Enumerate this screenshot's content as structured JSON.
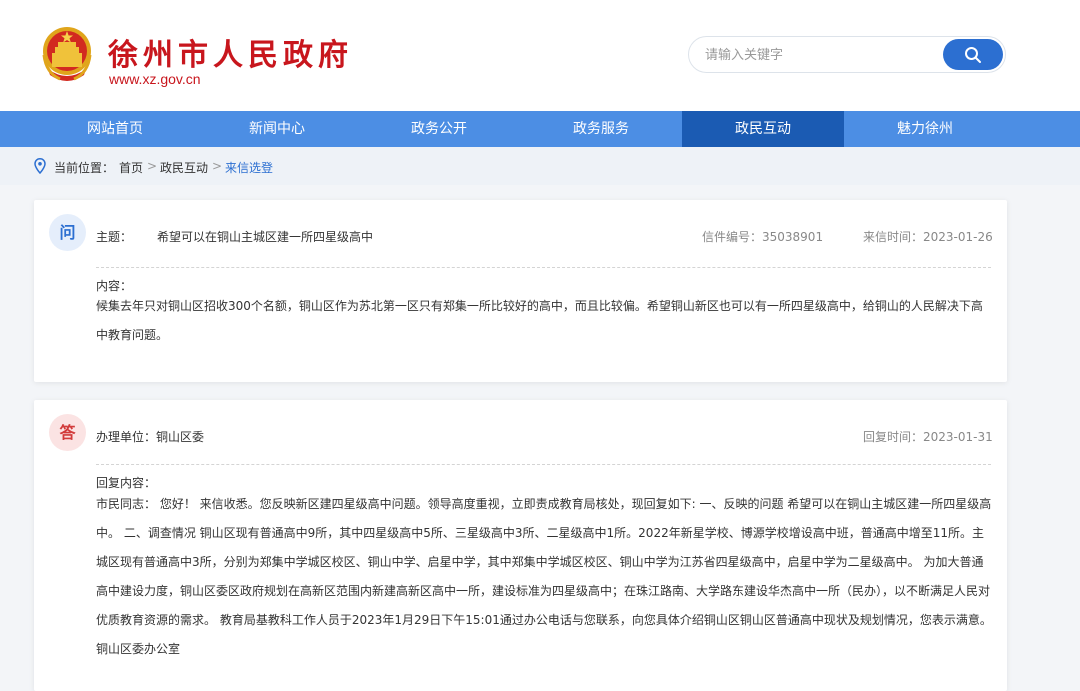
{
  "header": {
    "site_name": "徐州市人民政府",
    "site_url": "www.xz.gov.cn",
    "search_placeholder": "请输入关键字",
    "search_icon": "magnifier-icon",
    "emblem": "national-emblem-icon"
  },
  "nav": {
    "items": [
      {
        "label": "网站首页"
      },
      {
        "label": "新闻中心"
      },
      {
        "label": "政务公开"
      },
      {
        "label": "政务服务"
      },
      {
        "label": "政民互动",
        "active": true
      },
      {
        "label": "魅力徐州"
      }
    ]
  },
  "breadcrumb": {
    "prefix": "当前位置：",
    "home": "首页",
    "section": "政民互动",
    "current": "来信选登",
    "sep": ">"
  },
  "letter": {
    "badge": "问",
    "subject_label": "主题：",
    "subject": "希望可以在铜山主城区建一所四星级高中",
    "number_text": "信件编号：35038901",
    "date_text": "来信时间：2023-01-26",
    "content_label": "内容：",
    "content": "候集去年只对铜山区招收300个名额，铜山区作为苏北第一区只有郑集一所比较好的高中，而且比较偏。希望铜山新区也可以有一所四星级高中，给铜山的人民解决下高中教育问题。"
  },
  "reply": {
    "badge": "答",
    "unit_text": "办理单位：铜山区委",
    "date_text": "回复时间：2023-01-31",
    "content_label": "回复内容：",
    "content": "市民同志： 您好！ 来信收悉。您反映新区建四星级高中问题。领导高度重视，立即责成教育局核处，现回复如下: 一、反映的问题 希望可以在铜山主城区建一所四星级高中。 二、调查情况 铜山区现有普通高中9所，其中四星级高中5所、三星级高中3所、二星级高中1所。2022年新星学校、博源学校增设高中班，普通高中增至11所。主城区现有普通高中3所，分别为郑集中学城区校区、铜山中学、启星中学，其中郑集中学城区校区、铜山中学为江苏省四星级高中，启星中学为二星级高中。 为加大普通高中建设力度，铜山区委区政府规划在高新区范围内新建高新区高中一所，建设标准为四星级高中；在珠江路南、大学路东建设华杰高中一所（民办），以不断满足人民对优质教育资源的需求。 教育局基教科工作人员于2023年1月29日下午15:01通过办公电话与您联系，向您具体介绍铜山区铜山区普通高中现状及规划情况，您表示满意。 铜山区委办公室"
  },
  "colors": {
    "brand_red": "#c8161d",
    "nav_blue": "#4c8ee4",
    "nav_active": "#1b5bb3",
    "accent_blue": "#2c6fd1"
  }
}
